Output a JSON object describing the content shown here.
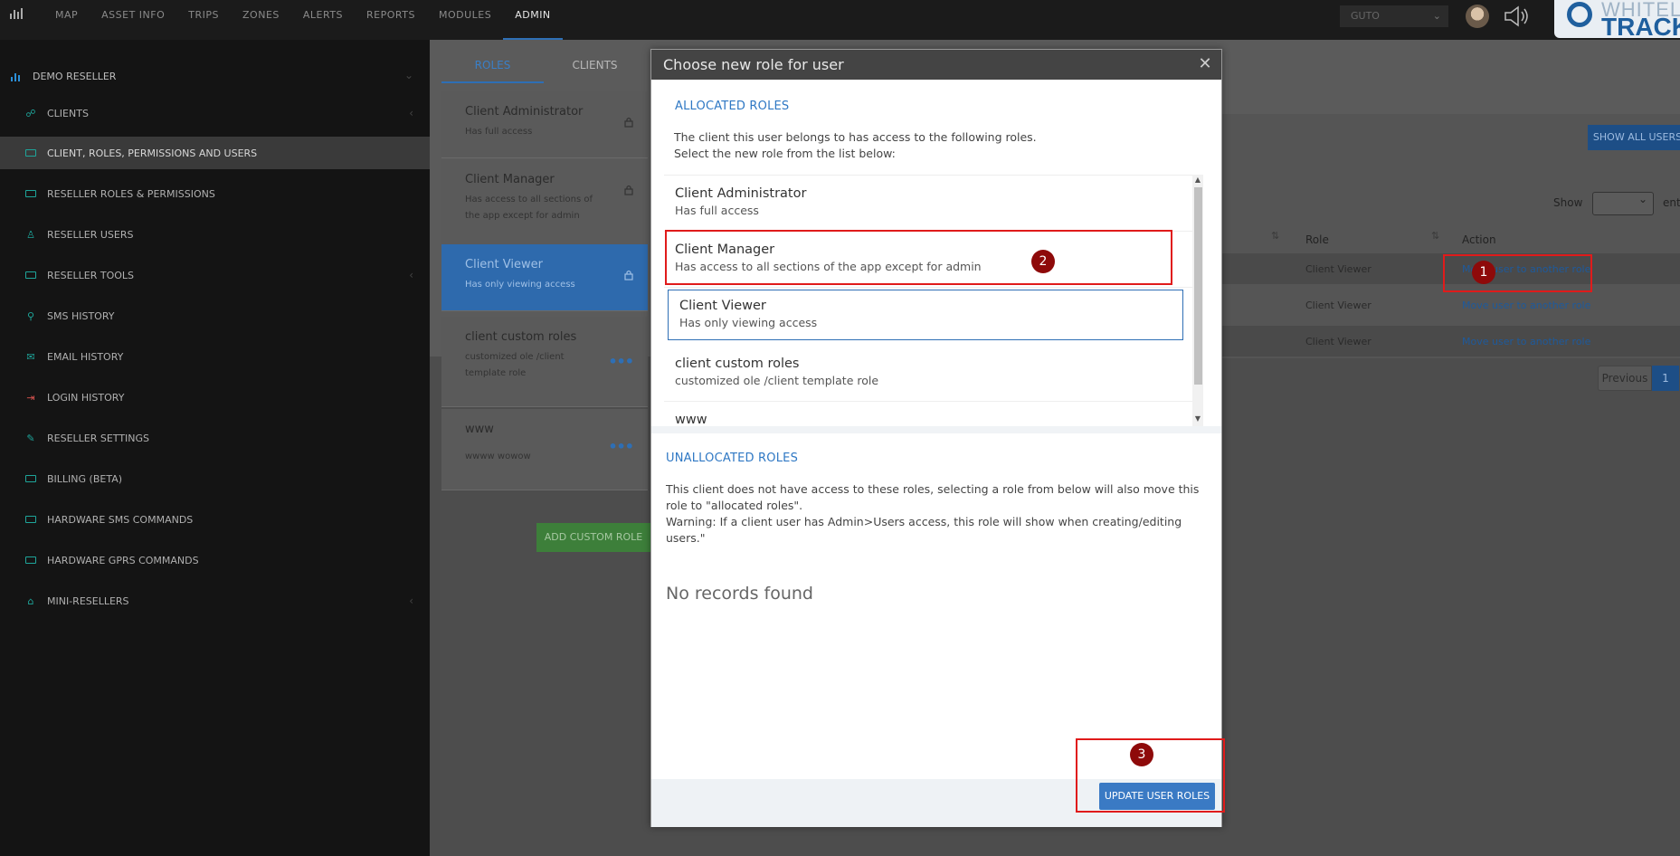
{
  "topbar": {
    "nav": [
      "MAP",
      "ASSET INFO",
      "TRIPS",
      "ZONES",
      "ALERTS",
      "REPORTS",
      "MODULES",
      "ADMIN"
    ],
    "active_nav": "ADMIN",
    "user_select": "GUTO",
    "brand_top": "WHITELA",
    "brand_bottom": "TRACKI"
  },
  "sidebar": {
    "header": "DEMO RESELLER",
    "items": [
      {
        "label": "CLIENTS",
        "icon": "users-icon"
      },
      {
        "label": "CLIENT, ROLES, PERMISSIONS AND USERS",
        "icon": "card-icon",
        "active": true
      },
      {
        "label": "RESELLER ROLES & PERMISSIONS",
        "icon": "card-icon"
      },
      {
        "label": "RESELLER USERS",
        "icon": "user-icon"
      },
      {
        "label": "RESELLER TOOLS",
        "icon": "card-icon"
      },
      {
        "label": "SMS HISTORY",
        "icon": "search-icon"
      },
      {
        "label": "EMAIL HISTORY",
        "icon": "mail-icon"
      },
      {
        "label": "LOGIN HISTORY",
        "icon": "login-icon"
      },
      {
        "label": "RESELLER SETTINGS",
        "icon": "wrench-icon"
      },
      {
        "label": "BILLING (BETA)",
        "icon": "card-icon"
      },
      {
        "label": "HARDWARE SMS COMMANDS",
        "icon": "card-icon"
      },
      {
        "label": "HARDWARE GPRS COMMANDS",
        "icon": "card-icon"
      },
      {
        "label": "MINI-RESELLERS",
        "icon": "home-icon"
      }
    ]
  },
  "content": {
    "tabs": [
      "ROLES",
      "CLIENTS"
    ],
    "roles": [
      {
        "name": "Client Administrator",
        "desc": "Has full access"
      },
      {
        "name": "Client Manager",
        "desc": "Has access to all sections of the app except for admin"
      },
      {
        "name": "Client Viewer",
        "desc": "Has only viewing access"
      },
      {
        "name": "client custom roles",
        "desc": "customized ole /client template role"
      },
      {
        "name": "www",
        "desc": "wwww wowow"
      }
    ],
    "add_custom_role": "ADD CUSTOM ROLE",
    "show_all_users": "SHOW ALL USERS",
    "show_label": "Show",
    "entries_label": "ent",
    "table_headers": {
      "role": "Role",
      "action": "Action"
    },
    "rows": [
      {
        "role": "Client Viewer",
        "action": "Move user to another role"
      },
      {
        "role": "Client Viewer",
        "action": "Move user to another role"
      },
      {
        "role": "Client Viewer",
        "action": "Move user to another role"
      }
    ],
    "pagination": {
      "previous": "Previous",
      "page": "1"
    }
  },
  "modal": {
    "title": "Choose new role for user",
    "allocated_title": "ALLOCATED ROLES",
    "allocated_desc_1": "The client this user belongs to has access to the following roles.",
    "allocated_desc_2": "Select the new role from the list below:",
    "allocated_roles": [
      {
        "name": "Client Administrator",
        "desc": "Has full access"
      },
      {
        "name": "Client Manager",
        "desc": "Has access to all sections of the app except for admin"
      },
      {
        "name": "Client Viewer",
        "desc": "Has only viewing access"
      },
      {
        "name": "client custom roles",
        "desc": "customized ole /client template role"
      },
      {
        "name": "www",
        "desc": ""
      }
    ],
    "unallocated_title": "UNALLOCATED ROLES",
    "unallocated_desc_1": "This client does not have access to these roles, selecting a role from below will also move this",
    "unallocated_desc_2": "role to \"allocated roles\".",
    "unallocated_desc_3": "Warning: If a client user has Admin>Users access, this role will show when creating/editing",
    "unallocated_desc_4": "users.\"",
    "no_records": "No records found",
    "update_button": "UPDATE USER ROLES"
  },
  "annotations": [
    "1",
    "2",
    "3"
  ],
  "colors": {
    "accent": "#2e6fb5",
    "annotation_red": "#e01b1b",
    "badge": "#8e0a0a"
  }
}
